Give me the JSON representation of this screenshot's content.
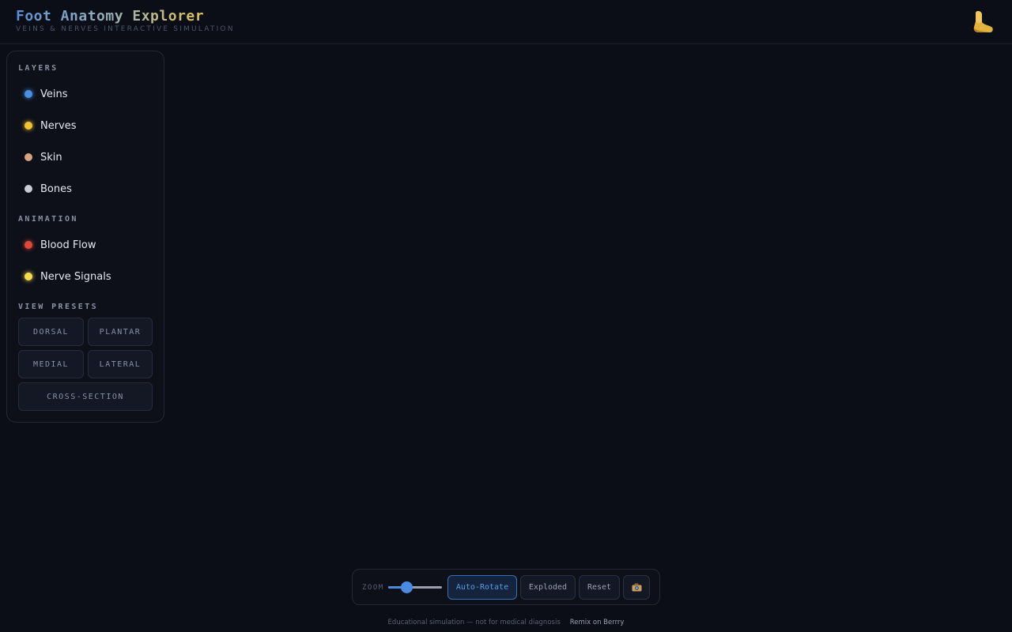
{
  "header": {
    "title": "Foot Anatomy Explorer",
    "subtitle": "VEINS & NERVES INTERACTIVE SIMULATION",
    "logo_icon": "foot-icon"
  },
  "panel": {
    "layers_title": "LAYERS",
    "layers": [
      {
        "label": "Veins",
        "color": "#4a90e2"
      },
      {
        "label": "Nerves",
        "color": "#f2c233"
      },
      {
        "label": "Skin",
        "color": "#d8a47f"
      },
      {
        "label": "Bones",
        "color": "#c7ccd6"
      }
    ],
    "animation_title": "ANIMATION",
    "animation": [
      {
        "label": "Blood Flow",
        "color": "#e0493a"
      },
      {
        "label": "Nerve Signals",
        "color": "#f5dc4a"
      }
    ],
    "presets_title": "VIEW PRESETS",
    "presets": [
      "DORSAL",
      "PLANTAR",
      "MEDIAL",
      "LATERAL",
      "CROSS-SECTION"
    ]
  },
  "toolbar": {
    "zoom_label": "ZOOM",
    "zoom_level": 0.3,
    "accent_color": "#4a8be0",
    "auto_rotate": "Auto-Rotate",
    "exploded": "Exploded",
    "reset": "Reset",
    "screenshot_icon": "camera-icon"
  },
  "footer": {
    "note": "Educational simulation — not for medical diagnosis",
    "remix": "Remix on Berrry"
  }
}
